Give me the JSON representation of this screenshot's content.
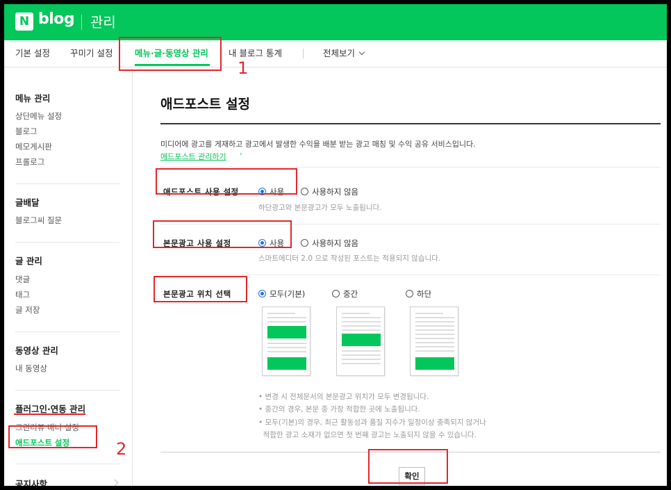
{
  "header": {
    "logo_n": "N",
    "logo_text": "blog",
    "section": "관리"
  },
  "nav": {
    "tabs": [
      {
        "label": "기본 설정"
      },
      {
        "label": "꾸미기 설정"
      },
      {
        "label": "메뉴·글·동영상 관리",
        "active": true
      },
      {
        "label": "내 블로그 통계"
      }
    ],
    "all_view": "전체보기"
  },
  "sidebar": {
    "groups": [
      {
        "title": "메뉴 관리",
        "items": [
          "상단메뉴 설정",
          "블로그",
          "메모게시판",
          "프롤로그"
        ]
      },
      {
        "title": "글배달",
        "items": [
          "블로그씨 질문"
        ]
      },
      {
        "title": "글 관리",
        "items": [
          "댓글",
          "태그",
          "글 저장"
        ]
      },
      {
        "title": "동영상 관리",
        "items": [
          "내 동영상"
        ]
      },
      {
        "title": "플러그인·연동 관리",
        "items": [
          "그린리뷰 배너 설정",
          "애드포스트 설정"
        ],
        "active_item": "애드포스트 설정"
      },
      {
        "title": "공지사항",
        "items": []
      }
    ]
  },
  "main": {
    "title": "애드포스트 설정",
    "description": "미디어에 광고를 게재하고 광고에서 발생한 수익을 배분 받는 광고 매칭 및 수익 공유 서비스입니다.",
    "link": "애드포스트 관리하기",
    "rows": [
      {
        "label": "애드포스트 사용 설정",
        "options": [
          "사용",
          "사용하지 않음"
        ],
        "selected": "사용",
        "hint": "하단광고와 본문광고가 모두 노출됩니다."
      },
      {
        "label": "본문광고 사용 설정",
        "options": [
          "사용",
          "사용하지 않음"
        ],
        "selected": "사용",
        "hint": "스마트에디터 2.0 으로 작성된 포스트는 적용되지 않습니다."
      },
      {
        "label": "본문광고 위치 선택",
        "options": [
          "모두(기본)",
          "중간",
          "하단"
        ],
        "selected": "모두(기본)"
      }
    ],
    "notes": [
      "• 변경 시 전체문서의 본문광고 위치가 모두 변경됩니다.",
      "• 중간의 경우, 본문 중 가장 적합한 곳에 노출됩니다.",
      "• 모두(기본)의 경우, 최근 활동성과 품질 지수가 일정이상 충족되지 않거나",
      "  적합한 광고 소재가 없으면 첫 번째 광고는 노출되지 않을 수 있습니다."
    ],
    "confirm": "확인"
  },
  "annotations": {
    "num1": "1",
    "num2": "2",
    "color": "#e4252b"
  },
  "colors": {
    "brand": "#03c75a",
    "radio": "#1a73e8"
  }
}
